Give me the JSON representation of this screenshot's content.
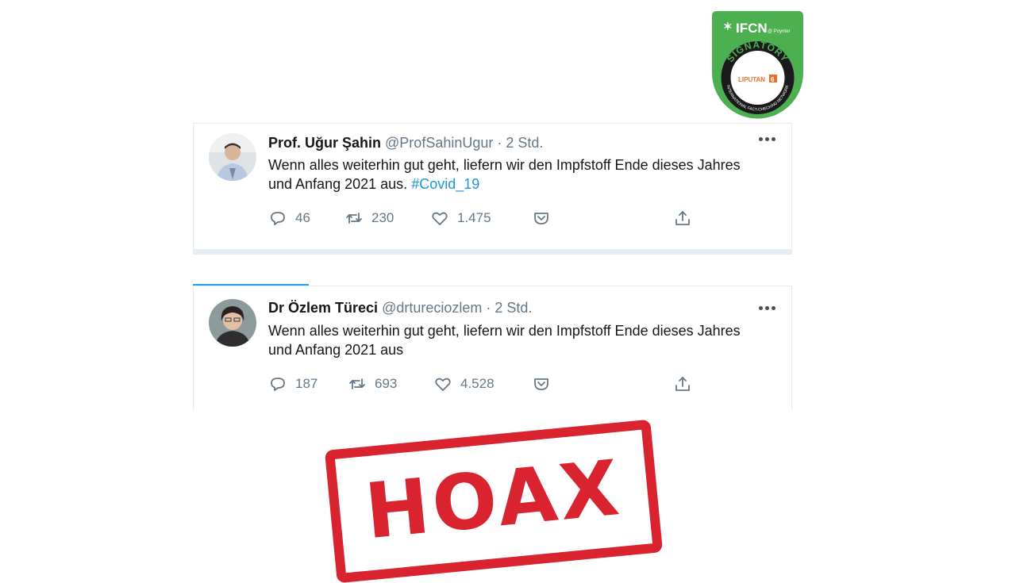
{
  "badge": {
    "org": "IFCN",
    "sub": "@ Poynter",
    "signatory": "SIGNATORY",
    "member": "LIPUTAN 6",
    "ring_text": "INTERNATIONAL FACT-CHECKING NETWORK",
    "color": "#4caf50"
  },
  "tweets": [
    {
      "name": "Prof. Uğur Şahin",
      "handle": "@ProfSahinUgur",
      "dot": "·",
      "time": "2 Std.",
      "text": "Wenn alles weiterhin gut geht, liefern wir den Impfstoff Ende dieses Jahres und Anfang 2021 aus.",
      "hashtag": "#Covid_19",
      "replies": "46",
      "retweets": "230",
      "likes": "1.475"
    },
    {
      "name": "Dr Özlem Türeci",
      "handle": "@drtureciozlem",
      "dot": "·",
      "time": "2 Std.",
      "text": "Wenn alles weiterhin gut geht, liefern wir den Impfstoff Ende dieses Jahres und Anfang 2021 aus",
      "hashtag": "",
      "replies": "187",
      "retweets": "693",
      "likes": "4.528"
    }
  ],
  "stamp": {
    "label": "HOAX",
    "color": "#d9232e"
  },
  "colors": {
    "link": "#1b95e0",
    "muted": "#657786",
    "accent": "#1da1f2"
  }
}
